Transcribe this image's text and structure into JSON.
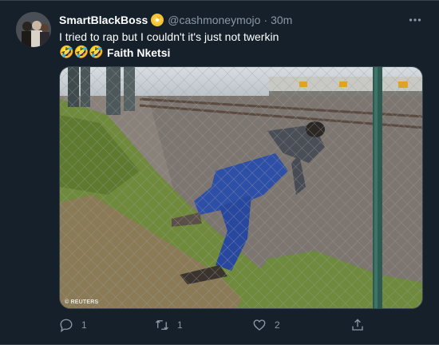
{
  "author": {
    "display_name": "SmartBlackBoss",
    "handle": "@cashmoneymojo",
    "separator": "·",
    "time": "30m"
  },
  "tweet": {
    "line1": "I tried to rap but I couldn't it's just not twerkin",
    "emojis": "🤣🤣🤣",
    "tagged": "Faith Nketsi"
  },
  "media": {
    "watermark": "© REUTERS"
  },
  "actions": {
    "reply_count": "1",
    "retweet_count": "1",
    "like_count": "2"
  },
  "icons": {
    "more": "more-options-icon",
    "reply": "reply-icon",
    "retweet": "retweet-icon",
    "like": "like-icon",
    "share": "share-icon",
    "badge": "verified-badge-icon"
  },
  "colors": {
    "background": "#15202b",
    "secondary_text": "#8b98a5",
    "border": "#38444d"
  }
}
